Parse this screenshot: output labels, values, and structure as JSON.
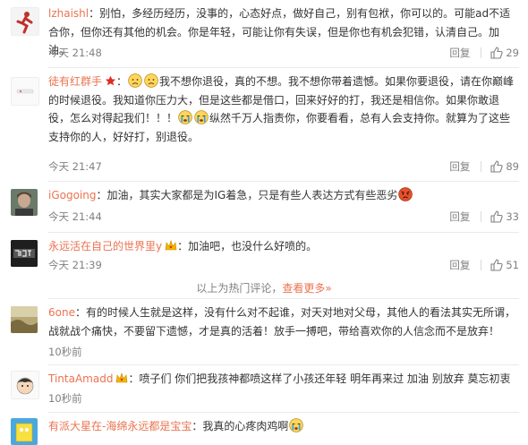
{
  "labels": {
    "reply": "回复"
  },
  "colors": {
    "name": "#eb7350",
    "meta": "#808080",
    "text": "#333333"
  },
  "comments": [
    {
      "user": "lzhaishl",
      "text": "：别怕，多经历经历，没事的，心态好点，做好自己，别有包袱，你可以的。可能ad不适合你，但你还有其他的机会。你是年轻，可能让你有失误，但是你也有机会犯错，认清自己。加油。",
      "time": "今天 21:48",
      "likes": "29"
    },
    {
      "user": "徒有红群手",
      "text_a": "我不想你退役，真的不想。我不想你带着遗憾。如果你要退役，请在你巅峰的时候退役。我知道你压力大，但是这些都是借口，回来好好的打，我还是相信你。如果你敢退役，怎么对得起我们！！！",
      "text_b": "纵然千万人指责你，你要看看，总有人会支持你。就算为了这些支持你的人，好好打，别退役。",
      "time": "今天 21:47",
      "likes": "89"
    },
    {
      "user": "iGogoing",
      "text": "：加油，其实大家都是为IG着急，只是有些人表达方式有些恶劣",
      "time": "今天 21:44",
      "likes": "33"
    },
    {
      "user": "永远活在自己的世界里y",
      "text": "：加油吧，也没什么好喷的。",
      "time": "今天 21:39",
      "likes": "51"
    },
    {
      "user": "6one",
      "text": "：有的时候人生就是这样，没有什么对不起谁，对天对地对父母，其他人的看法其实无所谓，战就战个痛快，不要留下遗憾，才是真的活着！放手一搏吧，带给喜欢你的人信念而不是放弃！",
      "time": "10秒前"
    },
    {
      "user": "TintaAmadd",
      "text": "：喷子们 你们把我孩神都喷这样了小孩还年轻 明年再来过 加油 别放弃 莫忘初衷",
      "time": "10秒前"
    },
    {
      "user": "有派大星在-海绵永远都是宝宝",
      "text": "：我真的心疼肉鸡啊"
    }
  ],
  "hot_divider": {
    "text": "以上为热门评论，",
    "link": "查看更多»"
  }
}
